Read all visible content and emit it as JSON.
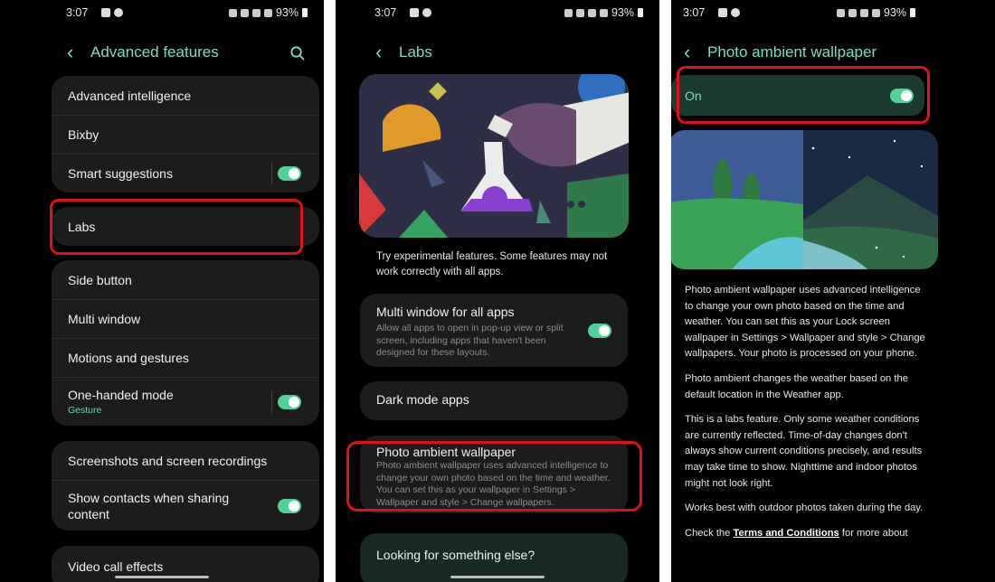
{
  "status": {
    "time": "3:07",
    "battery": "93%"
  },
  "screen1": {
    "title": "Advanced features",
    "groups": [
      [
        {
          "label": "Advanced intelligence"
        },
        {
          "label": "Bixby"
        },
        {
          "label": "Smart suggestions",
          "toggle": true
        }
      ],
      [
        {
          "label": "Labs"
        }
      ],
      [
        {
          "label": "Side button"
        },
        {
          "label": "Multi window"
        },
        {
          "label": "Motions and gestures"
        },
        {
          "label": "One-handed mode",
          "sub": "Gesture",
          "toggle": true
        }
      ],
      [
        {
          "label": "Screenshots and screen recordings"
        },
        {
          "label": "Show contacts when sharing content",
          "toggle": true
        }
      ],
      [
        {
          "label": "Video call effects"
        }
      ]
    ]
  },
  "screen2": {
    "title": "Labs",
    "intro": "Try experimental features. Some features may not work correctly with all apps.",
    "items": [
      {
        "title": "Multi window for all apps",
        "desc": "Allow all apps to open in pop-up view or split screen, including apps that haven't been designed for these layouts.",
        "toggle": true
      },
      {
        "title": "Dark mode apps",
        "desc": ""
      },
      {
        "title": "Photo ambient wallpaper",
        "desc": "Photo ambient wallpaper uses advanced intelligence to change your own photo based on the time and weather. You can set this as your wallpaper in Settings > Wallpaper and style > Change wallpapers."
      },
      {
        "title": "Looking for something else?",
        "desc": ""
      }
    ]
  },
  "screen3": {
    "title": "Photo ambient wallpaper",
    "switch_label": "On",
    "paragraphs": [
      "Photo ambient wallpaper uses advanced intelligence to change your own photo based on the time and weather. You can set this as your Lock screen wallpaper in Settings > Wallpaper and style > Change wallpapers. Your photo is processed on your phone.",
      "Photo ambient changes the weather based on the default location in the Weather app.",
      "This is a labs feature. Only some weather conditions are currently reflected. Time-of-day changes don't always show current conditions precisely, and results may take time to show. Nighttime and indoor photos might not look right.",
      "Works best with outdoor photos taken during the day."
    ],
    "terms_prefix": "Check the ",
    "terms_link": "Terms and Conditions",
    "terms_suffix": " for more about"
  },
  "colors": {
    "accent": "#7fdcb7",
    "toggle": "#4fd29a",
    "highlight": "#e0101a",
    "card": "#1c1c1c"
  }
}
